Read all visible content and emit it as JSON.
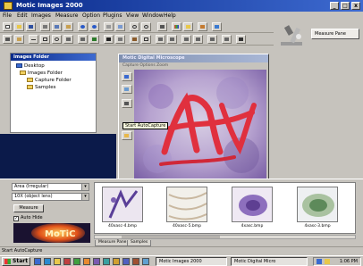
{
  "app": {
    "title": "Motic Images 2000"
  },
  "menu": [
    "File",
    "Edit",
    "Images",
    "Measure",
    "Option",
    "Plugins",
    "View",
    "Window",
    "Help"
  ],
  "measure_panel_label": "Measure Pane",
  "folders_panel": {
    "title": "Images Folder",
    "items": [
      {
        "label": "Desktop"
      },
      {
        "label": "Images Folder"
      },
      {
        "label": "Capture Folder"
      },
      {
        "label": "Samples"
      }
    ]
  },
  "scope_window": {
    "title": "Motic Digital Microscope",
    "menu": "Capture  Options  Zoom",
    "tooltip": "Start AutoCapture"
  },
  "bottom": {
    "dropdown_1": "Area (Irregular)",
    "dropdown_2": "10X (object lens)",
    "measure_button": "Measure",
    "autohide_label": "Auto Hide",
    "logo_text": "MoTiC"
  },
  "thumbnails": [
    {
      "label": "40xasc-4.bmp"
    },
    {
      "label": "40xasc-5.bmp"
    },
    {
      "label": "4xasc.bmp"
    },
    {
      "label": "4xasc-3.bmp"
    }
  ],
  "tabs": [
    "Measure Pane",
    "Samples"
  ],
  "status_text": "Start AutoCapture",
  "taskbar": {
    "start_label": "Start",
    "tasks": [
      "Motic Images 2000",
      "Motic Digital Micro"
    ],
    "clock": "1:06 PM"
  },
  "colors": {
    "titlebar_active": "#0a2a8a",
    "titlebar_inactive": "#7f8faf",
    "desktop": "#0b1a4a",
    "window_face": "#c6c3bd",
    "stain_red": "#e0303e",
    "stain_purple": "#6a3f98"
  }
}
